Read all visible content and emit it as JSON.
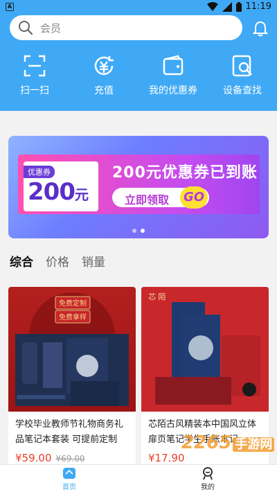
{
  "status_bar": {
    "time": "11:19"
  },
  "search": {
    "placeholder": "会员"
  },
  "quick_nav": [
    {
      "label": "扫一扫",
      "icon": "scan-icon"
    },
    {
      "label": "充值",
      "icon": "recharge-icon"
    },
    {
      "label": "我的优惠券",
      "icon": "wallet-icon"
    },
    {
      "label": "设备查找",
      "icon": "device-search-icon"
    }
  ],
  "banner": {
    "coupon_tag": "优惠券",
    "coupon_amount": "200",
    "coupon_unit": "元",
    "headline": "200元优惠券已到账",
    "cta": "立即领取",
    "go": "GO",
    "slide_count": 2,
    "active_slide": 1
  },
  "sort_tabs": [
    {
      "label": "综合",
      "active": true
    },
    {
      "label": "价格",
      "active": false
    },
    {
      "label": "销量",
      "active": false
    }
  ],
  "products": [
    {
      "title": "学校毕业教师节礼物商务礼品笔记本套装 可提前定制",
      "price": "¥59.00",
      "original_price": "¥69.00",
      "image_text": [
        "免费定制",
        "免费拿样"
      ]
    },
    {
      "title": "芯陌古风精装本中国风立体扉页笔记学生手账本记…",
      "price": "¥17.90",
      "original_price": "",
      "image_text": [
        "芯 陌"
      ]
    }
  ],
  "tabbar": [
    {
      "label": "首页",
      "active": true
    },
    {
      "label": "我的",
      "active": false
    }
  ],
  "watermark": {
    "text": "2265",
    "suffix": "手游网"
  },
  "colors": {
    "primary": "#3fa9f5",
    "price": "#e8402a"
  }
}
